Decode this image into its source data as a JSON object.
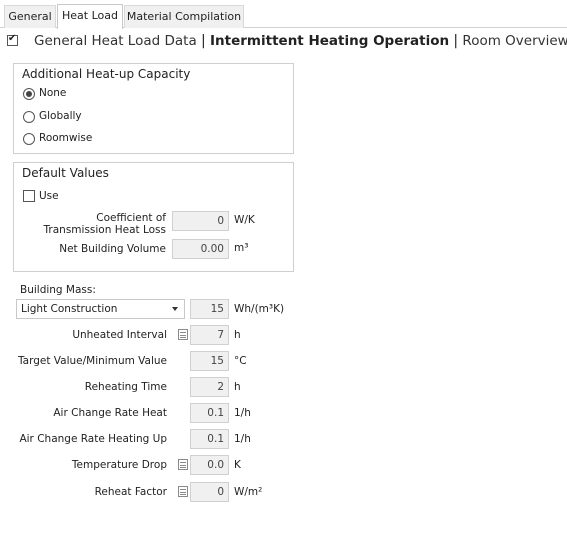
{
  "tabs": [
    {
      "label": "General"
    },
    {
      "label": "Heat Load"
    },
    {
      "label": "Material Compilation"
    }
  ],
  "breadcrumb": {
    "item1": "General Heat Load Data",
    "item2": "Intermittent Heating Operation",
    "item3": "Room Overview",
    "separator": "|"
  },
  "heatup": {
    "title": "Additional Heat-up Capacity",
    "options": [
      "None",
      "Globally",
      "Roomwise"
    ],
    "selected": "None"
  },
  "defaults": {
    "title": "Default Values",
    "use_label": "Use",
    "use_checked": false,
    "coef_label": "Coefficient of Transmission Heat Loss",
    "coef_value": "0",
    "coef_unit": "W/K",
    "volume_label": "Net Building Volume",
    "volume_value": "0.00",
    "volume_unit": "m³"
  },
  "mass": {
    "label": "Building Mass:",
    "selected": "Light Construction",
    "value": "15",
    "unit": "Wh/(m³K)"
  },
  "rows": [
    {
      "label": "Unheated Interval",
      "value": "7",
      "unit": "h",
      "calc": true
    },
    {
      "label": "Target Value/Minimum Value",
      "value": "15",
      "unit": "°C",
      "calc": false
    },
    {
      "label": "Reheating Time",
      "value": "2",
      "unit": "h",
      "calc": false
    },
    {
      "label": "Air Change Rate Heat",
      "value": "0.1",
      "unit": "1/h",
      "calc": false
    },
    {
      "label": "Air Change Rate Heating Up",
      "value": "0.1",
      "unit": "1/h",
      "calc": false
    },
    {
      "label": "Temperature Drop",
      "value": "0.0",
      "unit": "K",
      "calc": true
    },
    {
      "label": "Reheat Factor",
      "value": "0",
      "unit": "W/m²",
      "calc": true
    }
  ]
}
